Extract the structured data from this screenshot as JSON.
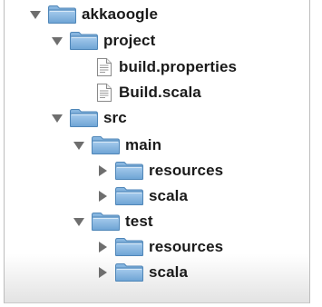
{
  "tree": {
    "root": {
      "label": "akkaoogle",
      "state": "expanded",
      "icon": "folder-icon"
    },
    "project": {
      "label": "project",
      "state": "expanded",
      "icon": "folder-icon",
      "files": [
        {
          "label": "build.properties",
          "icon": "document-icon"
        },
        {
          "label": "Build.scala",
          "icon": "document-icon"
        }
      ]
    },
    "src": {
      "label": "src",
      "state": "expanded",
      "icon": "folder-icon"
    },
    "main": {
      "label": "main",
      "state": "expanded",
      "icon": "folder-icon",
      "children": [
        {
          "label": "resources",
          "state": "collapsed",
          "icon": "folder-icon"
        },
        {
          "label": "scala",
          "state": "collapsed",
          "icon": "folder-icon"
        }
      ]
    },
    "test": {
      "label": "test",
      "state": "expanded",
      "icon": "folder-icon",
      "children": [
        {
          "label": "resources",
          "state": "collapsed",
          "icon": "folder-icon"
        },
        {
          "label": "scala",
          "state": "collapsed",
          "icon": "folder-icon"
        }
      ]
    }
  },
  "colors": {
    "folder_blue": "#7fb2dd",
    "disclosure_gray": "#6e6e6e",
    "text": "#1a1a1a"
  }
}
